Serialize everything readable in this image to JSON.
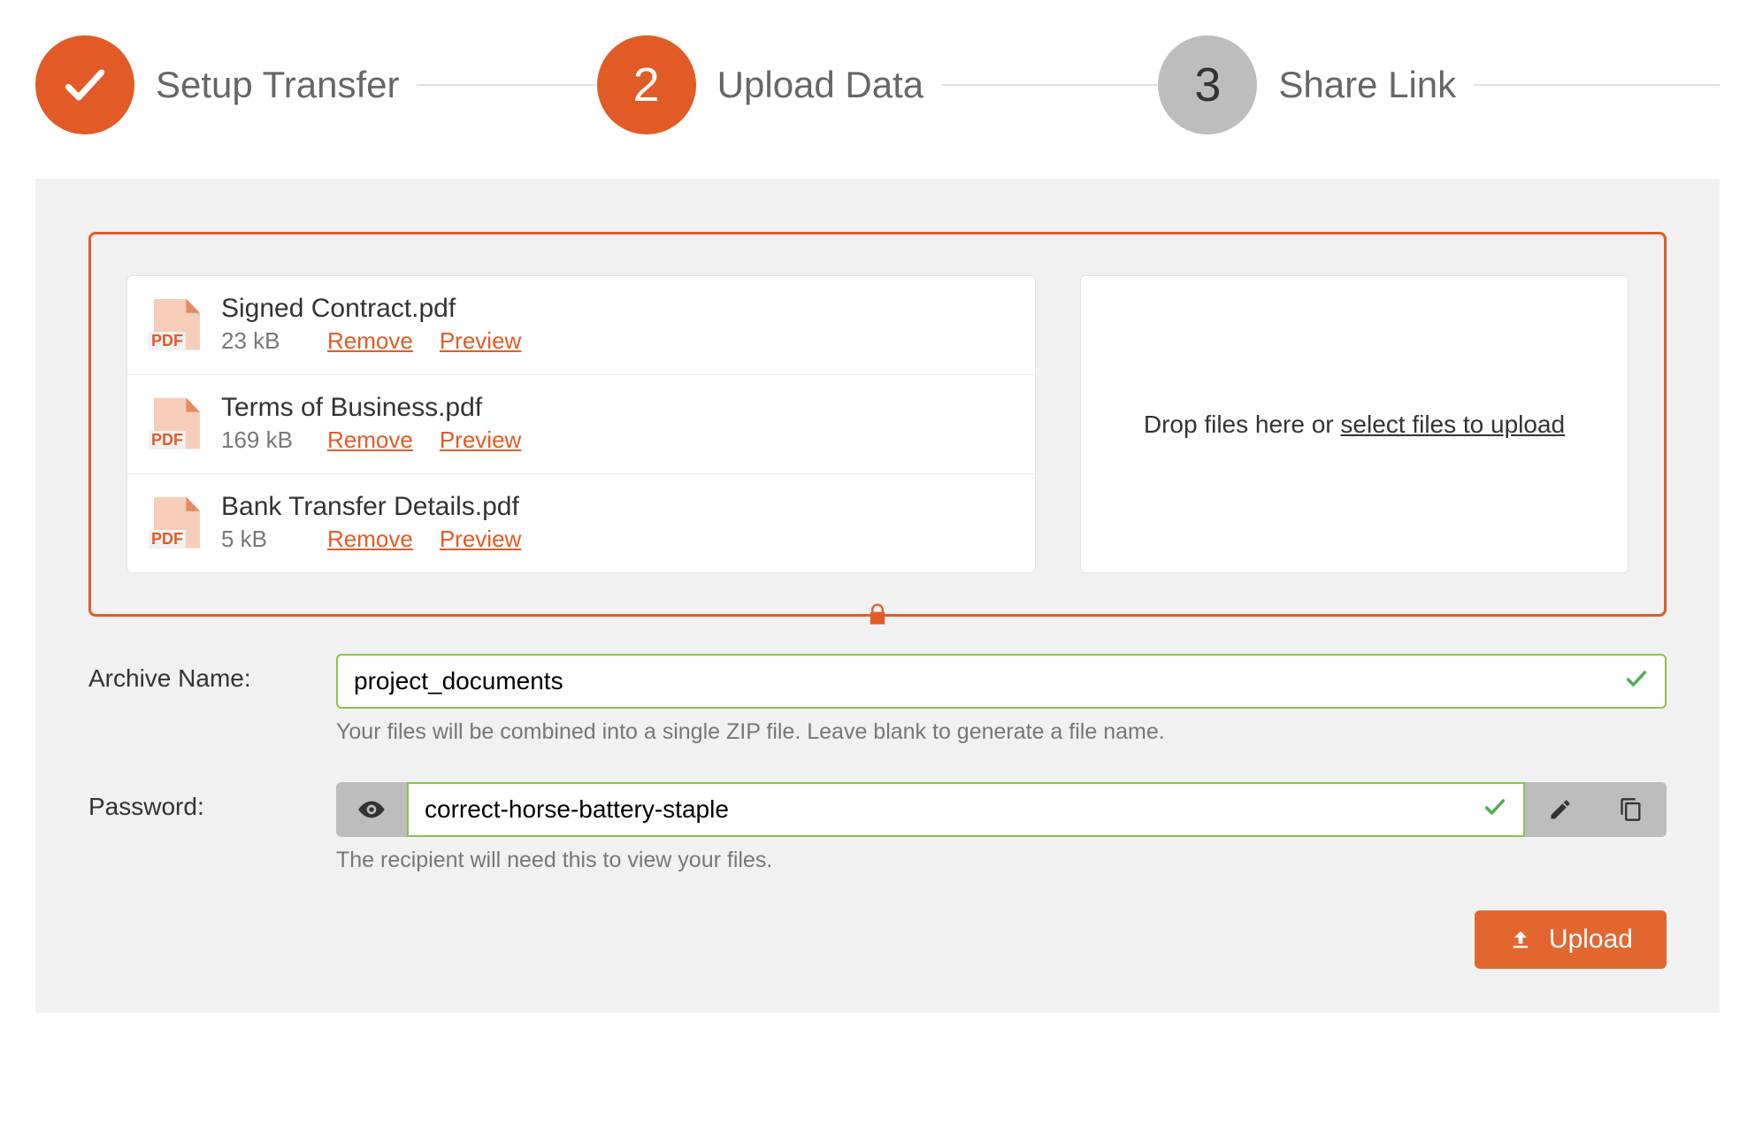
{
  "colors": {
    "accent": "#e25b26",
    "success": "#8bc34a",
    "grey_panel": "#f1f1f1",
    "grey_step": "#bdbdbd"
  },
  "stepper": {
    "steps": [
      {
        "label": "Setup Transfer",
        "state": "done"
      },
      {
        "label": "Upload Data",
        "state": "active",
        "number": "2"
      },
      {
        "label": "Share Link",
        "state": "pending",
        "number": "3"
      }
    ]
  },
  "files": [
    {
      "name": "Signed Contract.pdf",
      "size": "23 kB",
      "remove": "Remove",
      "preview": "Preview",
      "type": "PDF"
    },
    {
      "name": "Terms of Business.pdf",
      "size": "169 kB",
      "remove": "Remove",
      "preview": "Preview",
      "type": "PDF"
    },
    {
      "name": "Bank Transfer Details.pdf",
      "size": "5 kB",
      "remove": "Remove",
      "preview": "Preview",
      "type": "PDF"
    }
  ],
  "dropzone": {
    "text_prefix": "Drop files here or ",
    "select_text": "select files to upload"
  },
  "archive": {
    "label": "Archive Name:",
    "value": "project_documents",
    "helper": "Your files will be combined into a single ZIP file. Leave blank to generate a file name."
  },
  "password": {
    "label": "Password:",
    "value": "correct-horse-battery-staple",
    "helper": "The recipient will need this to view your files."
  },
  "actions": {
    "upload": "Upload"
  },
  "icons": {
    "pdf_badge": "PDF"
  }
}
